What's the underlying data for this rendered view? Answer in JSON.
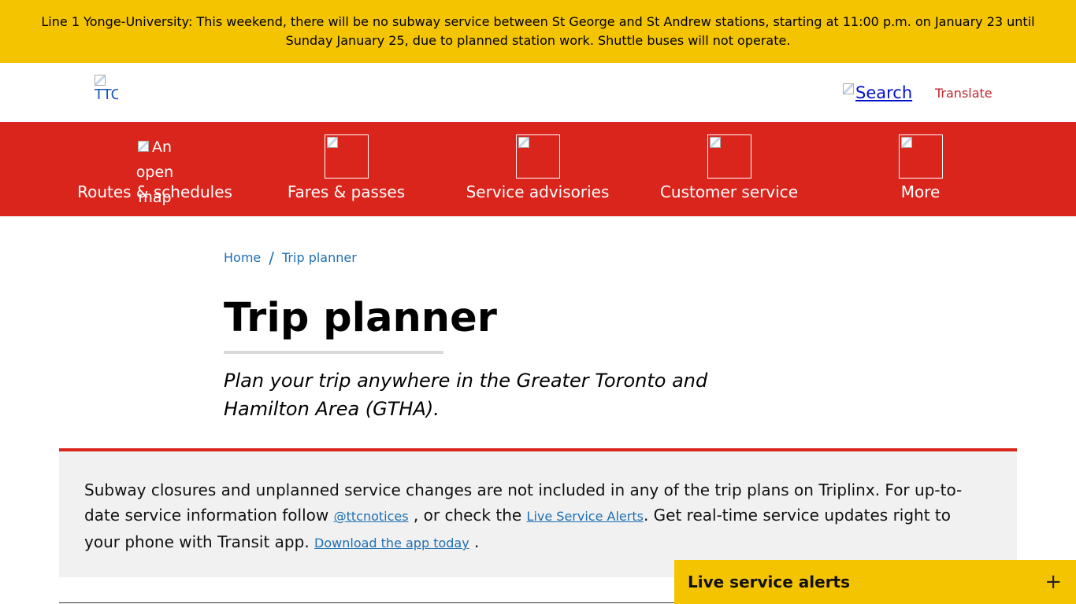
{
  "alert_banner": {
    "text": "Line 1 Yonge-University: This weekend, there will be no subway service between St George and St Andrew stations, starting at 11:00 p.m. on January 23 until Sunday January 25, due to planned station work. Shuttle buses will not operate."
  },
  "header": {
    "logo_alt": "TTC",
    "search_label": "Search",
    "translate_label": "Translate"
  },
  "nav": {
    "items": [
      {
        "label": "Routes & schedules",
        "icon_alt": "An open map",
        "icon": "map-icon"
      },
      {
        "label": "Fares & passes",
        "icon": "fares-icon"
      },
      {
        "label": "Service advisories",
        "icon": "advisories-icon"
      },
      {
        "label": "Customer service",
        "icon": "customer-service-icon"
      },
      {
        "label": "More",
        "icon": "more-icon"
      }
    ]
  },
  "breadcrumb": {
    "home": "Home",
    "separator": "/",
    "current": "Trip planner"
  },
  "page": {
    "title": "Trip planner",
    "lead": "Plan your trip anywhere in the Greater Toronto and Hamilton Area (GTHA)."
  },
  "notice": {
    "part1": "Subway closures and unplanned service changes are not included in any of the trip plans on Triplinx. For up-to-date service information follow ",
    "link_twitter": "@ttcnotices",
    "part2": " , or check the ",
    "link_alerts": "Live Service Alerts",
    "part3": ". Get real-time service updates right to your phone with Transit app. ",
    "link_app": "Download the app today",
    "part4": " ."
  },
  "live_alerts": {
    "label": "Live service alerts",
    "toggle": "+"
  },
  "colors": {
    "banner": "#f5c400",
    "nav_red": "#da251d",
    "link_blue": "#1f6fb2",
    "notice_bg": "#f1f1f1"
  }
}
